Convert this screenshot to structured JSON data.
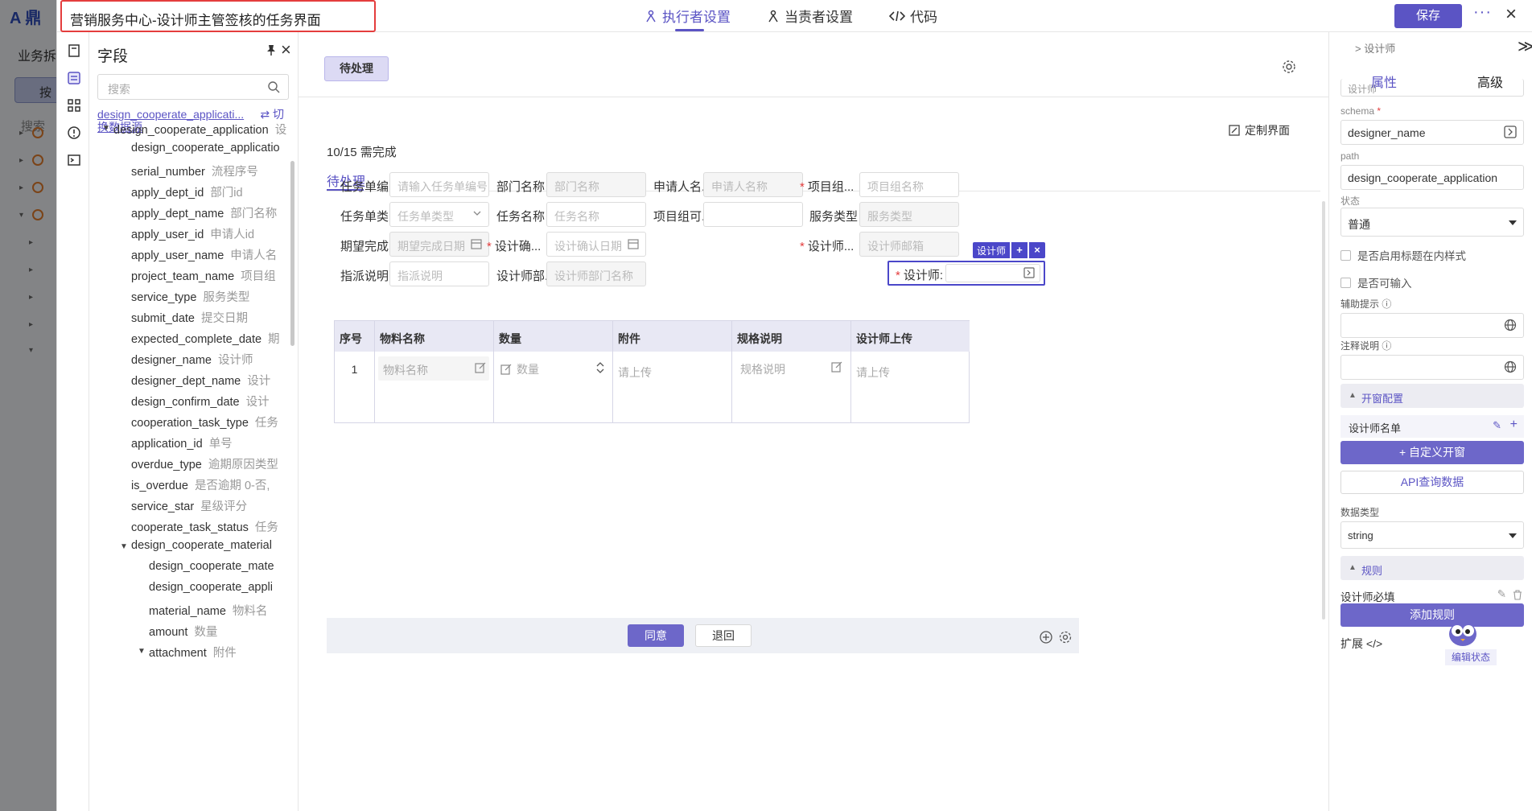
{
  "background": {
    "logo": "A 鼎",
    "section": "业务拆",
    "button": "按",
    "search": "搜索"
  },
  "topbar": {
    "page_title": "营销服务中心-设计师主管签核的任务界面",
    "tabs": [
      {
        "label": "执行者设置",
        "icon": "executor-icon",
        "active": true
      },
      {
        "label": "当责者设置",
        "icon": "user-icon",
        "active": false
      },
      {
        "label": "代码",
        "icon": "code-icon",
        "active": false
      }
    ],
    "save_label": "保存",
    "more_label": "···",
    "close_label": "×"
  },
  "fields_panel": {
    "title": "字段",
    "search_placeholder": "搜索",
    "datasource_name": "design_cooperate_applicati...",
    "switch_label_1": "⇄ 切",
    "switch_label_2": "换数据源",
    "tree": [
      {
        "name": "design_cooperate_application",
        "cn": "设",
        "depth": 0,
        "expanded": true
      },
      {
        "name": "design_cooperate_applicatio",
        "cn": "",
        "depth": 1
      },
      {
        "name": "serial_number",
        "cn": "流程序号",
        "depth": 1
      },
      {
        "name": "apply_dept_id",
        "cn": "部门id",
        "depth": 1
      },
      {
        "name": "apply_dept_name",
        "cn": "部门名称",
        "depth": 1
      },
      {
        "name": "apply_user_id",
        "cn": "申请人id",
        "depth": 1
      },
      {
        "name": "apply_user_name",
        "cn": "申请人名",
        "depth": 1
      },
      {
        "name": "project_team_name",
        "cn": "项目组",
        "depth": 1
      },
      {
        "name": "service_type",
        "cn": "服务类型",
        "depth": 1
      },
      {
        "name": "submit_date",
        "cn": "提交日期",
        "depth": 1
      },
      {
        "name": "expected_complete_date",
        "cn": "期",
        "depth": 1
      },
      {
        "name": "designer_name",
        "cn": "设计师",
        "depth": 1
      },
      {
        "name": "designer_dept_name",
        "cn": "设计",
        "depth": 1
      },
      {
        "name": "design_confirm_date",
        "cn": "设计",
        "depth": 1
      },
      {
        "name": "cooperation_task_type",
        "cn": "任务",
        "depth": 1
      },
      {
        "name": "application_id",
        "cn": "单号",
        "depth": 1
      },
      {
        "name": "overdue_type",
        "cn": "逾期原因类型",
        "depth": 1
      },
      {
        "name": "is_overdue",
        "cn": "是否逾期 0-否,",
        "depth": 1
      },
      {
        "name": "service_star",
        "cn": "星级评分",
        "depth": 1
      },
      {
        "name": "cooperate_task_status",
        "cn": "任务",
        "depth": 1
      },
      {
        "name": "design_cooperate_material",
        "cn": "",
        "depth": 1,
        "expanded": true
      },
      {
        "name": "design_cooperate_mate",
        "cn": "",
        "depth": 2
      },
      {
        "name": "design_cooperate_appli",
        "cn": "",
        "depth": 2
      },
      {
        "name": "material_name",
        "cn": "物料名",
        "depth": 2
      },
      {
        "name": "amount",
        "cn": "数量",
        "depth": 2
      },
      {
        "name": "attachment",
        "cn": "附件",
        "depth": 2,
        "expanded": true
      }
    ]
  },
  "center": {
    "pending_button": "待处理",
    "customize_label": "定制界面",
    "progress_text": "10/15 需完成",
    "subtab": "待处理",
    "form": [
      {
        "label": "任务单编...",
        "required": false,
        "placeholder": "请输入任务单编号",
        "disabled": false,
        "icon": ""
      },
      {
        "label": "部门名称 ...",
        "required": false,
        "placeholder": "部门名称",
        "disabled": true,
        "icon": ""
      },
      {
        "label": "申请人名...",
        "required": false,
        "placeholder": "申请人名称",
        "disabled": true,
        "icon": ""
      },
      {
        "label": "项目组...",
        "required": true,
        "placeholder": "项目组名称",
        "disabled": false,
        "icon": ""
      },
      {
        "label": "任务单类...",
        "required": false,
        "placeholder": "任务单类型",
        "disabled": false,
        "icon": "chevron"
      },
      {
        "label": "任务名称 ...",
        "required": false,
        "placeholder": "任务名称",
        "disabled": false,
        "icon": ""
      },
      {
        "label": "项目组可...",
        "required": false,
        "placeholder": "",
        "disabled": false,
        "icon": ""
      },
      {
        "label": "服务类型 ...",
        "required": false,
        "placeholder": "服务类型",
        "disabled": true,
        "icon": ""
      },
      {
        "label": "期望完成...",
        "required": false,
        "placeholder": "期望完成日期",
        "disabled": true,
        "icon": "calendar"
      },
      {
        "label": "设计确...",
        "required": true,
        "placeholder": "设计确认日期",
        "disabled": false,
        "icon": "calendar"
      },
      {
        "label": "设计师:",
        "required": true,
        "placeholder": "",
        "disabled": false,
        "icon": "open"
      },
      {
        "label": "设计师...",
        "required": true,
        "placeholder": "设计师邮箱",
        "disabled": true,
        "icon": ""
      },
      {
        "label": "指派说明 ...",
        "required": false,
        "placeholder": "指派说明",
        "disabled": false,
        "icon": ""
      },
      {
        "label": "设计师部...",
        "required": false,
        "placeholder": "设计师部门名称",
        "disabled": true,
        "icon": ""
      }
    ],
    "selected_tag": "设计师",
    "selected_add": "+",
    "selected_del": "×",
    "table": {
      "headers": [
        "序号",
        "物料名称",
        "数量",
        "附件",
        "规格说明",
        "设计师上传"
      ],
      "row_index": "1",
      "material_placeholder": "物料名称",
      "amount_placeholder": "数量",
      "attachment_placeholder": "请上传",
      "spec_placeholder": "规格说明",
      "upload_placeholder": "请上传"
    },
    "agree_label": "同意",
    "retreat_label": "退回"
  },
  "props": {
    "breadcrumb": "> 设计师",
    "collapse_label": "≫",
    "tabs": [
      "属性",
      "高级"
    ],
    "active_tab": "属性",
    "hidden_value": "设计师",
    "schema_label": "schema",
    "schema_value": "designer_name",
    "path_label": "path",
    "path_value": "design_cooperate_application",
    "status_label": "状态",
    "status_value": "普通",
    "check1": "是否启用标题在内样式",
    "check2": "是否可输入",
    "hint_label": "辅助提示",
    "note_label": "注释说明",
    "window_section": "开窗配置",
    "window_item": "设计师名单",
    "custom_window": "+ 自定义开窗",
    "api_query": "API查询数据",
    "datatype_label": "数据类型",
    "datatype_value": "string",
    "rules_section": "规则",
    "rule_item": "设计师必填",
    "add_rule": "添加规则",
    "extend_label": "扩展 </>",
    "edit_status": "编辑状态"
  },
  "colors": {
    "accent": "#5b54c4",
    "required": "#e43d3d",
    "title_border": "#e43d3d"
  }
}
